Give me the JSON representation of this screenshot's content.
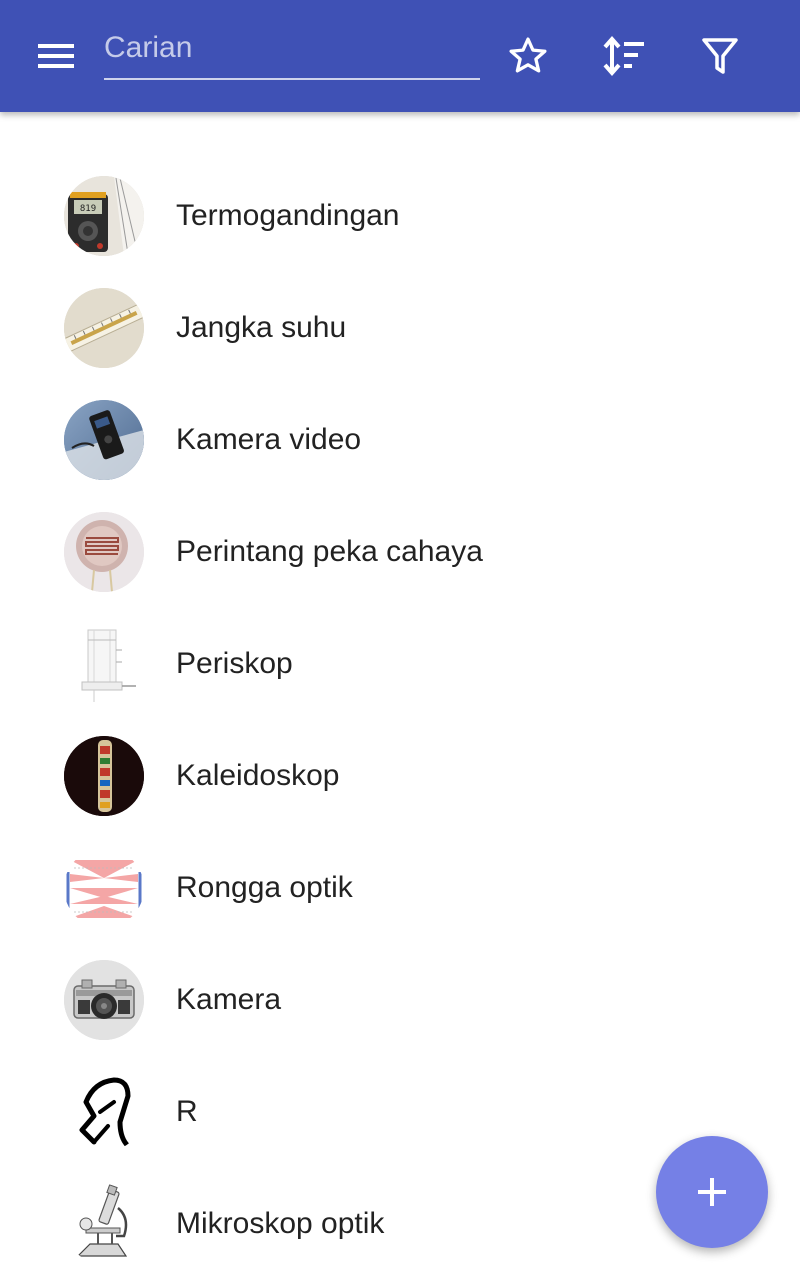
{
  "appbar": {
    "search_placeholder": "Carian",
    "search_value": "",
    "color": "#3f51b5"
  },
  "list": {
    "items": [
      {
        "label": "Termogandingan",
        "icon": "multimeter-thermocouple-image"
      },
      {
        "label": "Jangka suhu",
        "icon": "thermometer-image"
      },
      {
        "label": "Kamera video",
        "icon": "video-camera-image"
      },
      {
        "label": "Perintang peka cahaya",
        "icon": "photoresistor-image"
      },
      {
        "label": "Periskop",
        "icon": "periscope-image"
      },
      {
        "label": "Kaleidoskop",
        "icon": "kaleidoscope-image"
      },
      {
        "label": "Rongga optik",
        "icon": "optical-cavity-image"
      },
      {
        "label": "Kamera",
        "icon": "camera-image"
      },
      {
        "label": "R",
        "icon": "r-glyph-image"
      },
      {
        "label": "Mikroskop optik",
        "icon": "microscope-image"
      }
    ]
  },
  "fab": {
    "icon": "plus-icon",
    "color": "#7580e6"
  }
}
